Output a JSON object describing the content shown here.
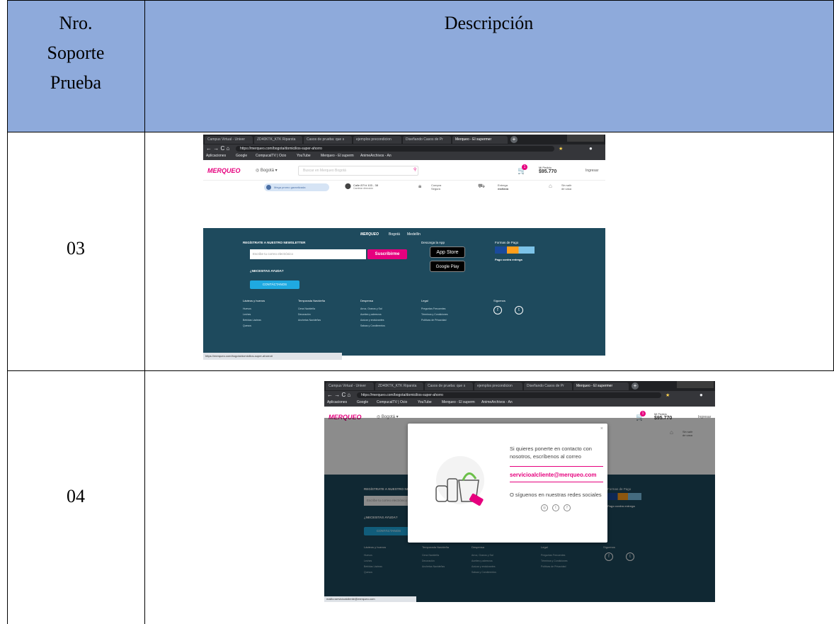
{
  "table": {
    "headers": {
      "nro": [
        "Nro.",
        "Soporte",
        "Prueba"
      ],
      "descripcion": "Descripción"
    },
    "rows": [
      {
        "id": "03"
      },
      {
        "id": "04"
      }
    ]
  },
  "browser": {
    "tabs": [
      "Campus Virtual - Univer",
      "ZD40KTK_KTK Riparsta",
      "Casos de prueba: que s",
      "ejemplos precondicion",
      "Diseñando Casos de Pr",
      "Merqueo - El supermer"
    ],
    "url": "https://merqueo.com/bogota/domicilios-super-ahorro",
    "bookmarks": [
      "Aplicaciones",
      "Google",
      "CompucalTV | Ocio",
      "YouTube",
      "Merqueo - El superm",
      "AnimeArchivos - An"
    ]
  },
  "merqueo": {
    "logo": "MERQUEO",
    "city": "Bogotá",
    "search_placeholder": "Buscar en Merqueo Bogotá",
    "cart_count": "1",
    "order_label": "Mi Pedido",
    "order_total": "$95.770",
    "login": "Ingresar",
    "strip": {
      "promo": "Mega promo garantizada",
      "address": "Calle 87f # 103 - 38",
      "address_sub": "Cambiar dirección",
      "secure": "Compra",
      "secure_sub": "Segura",
      "delivery": "Entrega",
      "delivery_sub": "mañana",
      "home": "Sin salir",
      "home_sub": "de casa"
    },
    "footer": {
      "newsletter_title": "REGÍSTRATE A NUESTRO NEWSLETTER",
      "email_placeholder": "Escribe tu correo electrónico",
      "subscribe": "Suscribirme",
      "help_title": "¿NECESITAS AYUDA?",
      "contact": "CONTÁCTANOS",
      "cities": [
        "Bogotá",
        "Medellín"
      ],
      "download_title": "Descarga la App",
      "app_store": "App Store",
      "google_play": "Google Play",
      "payment_title": "Formas de Pago",
      "payment_sub": "Pago contra entrega",
      "col1_title": "Lácteos y huevos",
      "col1": [
        "Huevos",
        "Leches",
        "Bebidas Lácteas",
        "Quesos"
      ],
      "col2_title": "Temporada Navideña",
      "col2": [
        "Cena Navideña",
        "Decoración",
        "Anchetas Navideñas"
      ],
      "col3_title": "Despensa",
      "col3": [
        "Arroz, Granos y Sal",
        "Aceites y aderezos",
        "Azúcar y endulzantes",
        "Salsas y Condimentos"
      ],
      "legal_title": "Legal",
      "legal": [
        "Preguntas Frecuentes",
        "Términos y Condiciones",
        "Políticas de Privacidad"
      ],
      "follow_title": "Síguenos"
    },
    "status_url_1": "https://merqueo.com/bogota/domicilios-super-ahorro#",
    "status_url_2": "mailto:servicioalcliente@merqueo.com"
  },
  "modal": {
    "line1": "Si quieres ponerte en contacto con",
    "line2": "nosotros, escríbenos al correo",
    "email": "servicioalcliente@merqueo.com",
    "social": "O síguenos en nuestras redes sociales"
  },
  "colors": {
    "header_bg": "#8eaadb",
    "merqueo_pink": "#e6007e",
    "footer_bg": "#1e4a5d"
  }
}
